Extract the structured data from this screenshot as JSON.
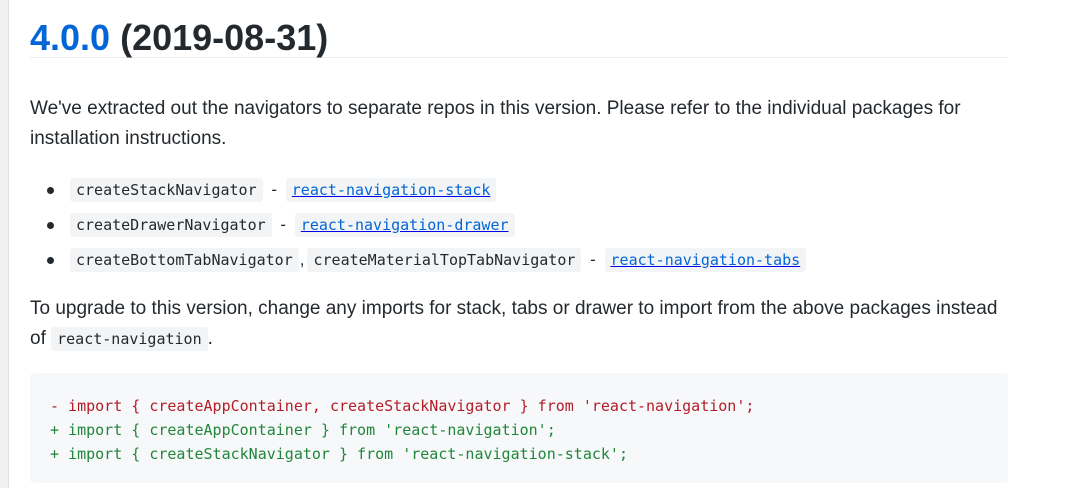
{
  "release": {
    "version": "4.0.0",
    "date": "(2019-08-31)"
  },
  "intro": "We've extracted out the navigators to separate repos in this version. Please refer to the individual packages for installation instructions.",
  "packages": [
    {
      "navigators": [
        "createStackNavigator"
      ],
      "separator": "-",
      "package": "react-navigation-stack"
    },
    {
      "navigators": [
        "createDrawerNavigator"
      ],
      "separator": "-",
      "package": "react-navigation-drawer"
    },
    {
      "navigators": [
        "createBottomTabNavigator",
        "createMaterialTopTabNavigator"
      ],
      "comma": ",",
      "separator": "-",
      "package": "react-navigation-tabs"
    }
  ],
  "upgrade": {
    "text_before": "To upgrade to this version, change any imports for stack, tabs or drawer to import from the above packages instead of ",
    "code": "react-navigation",
    "text_after": "."
  },
  "diff": [
    {
      "type": "removed",
      "text": "- import { createAppContainer, createStackNavigator } from 'react-navigation';"
    },
    {
      "type": "added",
      "text": "+ import { createAppContainer } from 'react-navigation';"
    },
    {
      "type": "added",
      "text": "+ import { createStackNavigator } from 'react-navigation-stack';"
    }
  ],
  "colors": {
    "link": "#0366d6",
    "text": "#24292e",
    "diff_removed": "#b31d28",
    "diff_added": "#22863a",
    "code_bg": "#f6f8fa"
  }
}
